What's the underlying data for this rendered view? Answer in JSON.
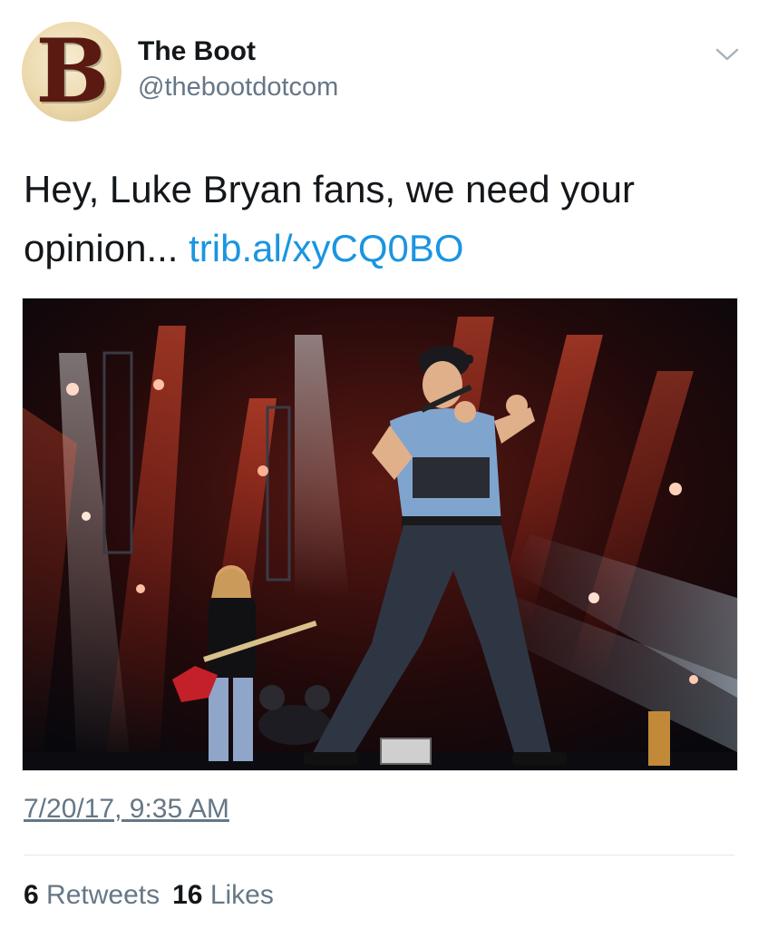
{
  "account": {
    "avatar_letter": "B",
    "name": "The Boot",
    "handle": "@thebootdotcom"
  },
  "tweet": {
    "text": "Hey, Luke Bryan fans, we need your opinion...",
    "link": "trib.al/xyCQ0BO",
    "timestamp": "7/20/17, 9:35 AM"
  },
  "stats": {
    "retweets_count": "6",
    "retweets_label": "Retweets",
    "likes_count": "16",
    "likes_label": "Likes"
  },
  "colors": {
    "link": "#1b95e0",
    "secondary_text": "#657786",
    "primary_text": "#14171a"
  },
  "icons": {
    "menu": "chevron-down-icon"
  }
}
